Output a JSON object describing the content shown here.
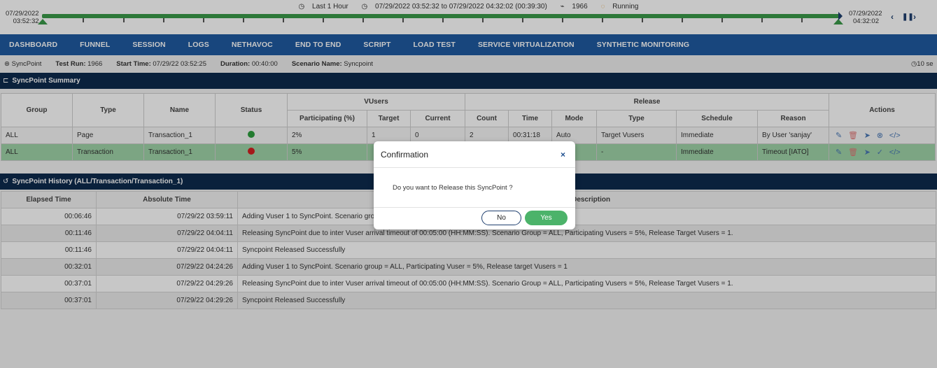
{
  "timeline": {
    "range_label": "Last 1 Hour",
    "time_window": "07/29/2022 03:52:32 to 07/29/2022 04:32:02 (00:39:30)",
    "test_run": "1966",
    "status": "Running",
    "start_date": "07/29/2022",
    "start_time": "03:52:32",
    "end_date": "07/29/2022",
    "end_time": "04:32:02"
  },
  "nav": {
    "items": [
      "DASHBOARD",
      "FUNNEL",
      "SESSION",
      "LOGS",
      "NETHAVOC",
      "END TO END",
      "SCRIPT",
      "LOAD TEST",
      "SERVICE VIRTUALIZATION",
      "SYNTHETIC MONITORING"
    ]
  },
  "info": {
    "page": "SyncPoint",
    "test_run_label": "Test Run:",
    "test_run_value": "1966",
    "start_label": "Start Time:",
    "start_value": "07/29/22 03:52:25",
    "duration_label": "Duration:",
    "duration_value": "00:40:00",
    "scenario_label": "Scenario Name:",
    "scenario_value": "Syncpoint",
    "refresh": "10 se"
  },
  "summary": {
    "title": "SyncPoint Summary",
    "headers": {
      "group": "Group",
      "type": "Type",
      "name": "Name",
      "status": "Status",
      "vusers": "VUsers",
      "release": "Release",
      "actions": "Actions",
      "participating": "Participating (%)",
      "target": "Target",
      "current": "Current",
      "count": "Count",
      "time": "Time",
      "mode": "Mode",
      "rtype": "Type",
      "schedule": "Schedule",
      "reason": "Reason"
    },
    "rows": [
      {
        "group": "ALL",
        "type": "Page",
        "name": "Transaction_1",
        "status_color": "#2e9e3e",
        "participating": "2%",
        "target": "1",
        "current": "0",
        "count": "2",
        "time": "00:31:18",
        "mode": "Auto",
        "rtype": "Target Vusers",
        "schedule": "Immediate",
        "reason": "By User 'sanjay'"
      },
      {
        "group": "ALL",
        "type": "Transaction",
        "name": "Transaction_1",
        "status_color": "#d42020",
        "participating": "5%",
        "target": "",
        "current": "",
        "count": "",
        "time": "",
        "mode": "al",
        "rtype": "-",
        "schedule": "Immediate",
        "reason": "Timeout [IATO]"
      }
    ]
  },
  "history": {
    "title": "SyncPoint History (ALL/Transaction/Transaction_1)",
    "headers": {
      "elapsed": "Elapsed Time",
      "absolute": "Absolute Time",
      "event": "nt Description"
    },
    "rows": [
      {
        "elapsed": "00:06:46",
        "absolute": "07/29/22 03:59:11",
        "event": "Adding Vuser 1 to SyncPoint. Scenario grou"
      },
      {
        "elapsed": "00:11:46",
        "absolute": "07/29/22 04:04:11",
        "event": "Releasing SyncPoint due to inter Vuser arrival timeout of 00:05:00 (HH:MM:SS). Scenario Group = ALL, Participating Vusers = 5%, Release Target Vusers = 1."
      },
      {
        "elapsed": "00:11:46",
        "absolute": "07/29/22 04:04:11",
        "event": "Syncpoint Released Successfully"
      },
      {
        "elapsed": "00:32:01",
        "absolute": "07/29/22 04:24:26",
        "event": "Adding Vuser 1 to SyncPoint. Scenario group = ALL, Participating Vuser = 5%, Release target Vusers = 1"
      },
      {
        "elapsed": "00:37:01",
        "absolute": "07/29/22 04:29:26",
        "event": "Releasing SyncPoint due to inter Vuser arrival timeout of 00:05:00 (HH:MM:SS). Scenario Group = ALL, Participating Vusers = 5%, Release Target Vusers = 1."
      },
      {
        "elapsed": "00:37:01",
        "absolute": "07/29/22 04:29:26",
        "event": "Syncpoint Released Successfully"
      }
    ]
  },
  "modal": {
    "title": "Confirmation",
    "close": "×",
    "message": "Do you want to Release  this SyncPoint ?",
    "no_label": "No",
    "yes_label": "Yes"
  },
  "colors": {
    "nav_bg": "#1f5aa0",
    "section_bg": "#0e2b4e",
    "timeline_green": "#3a9a4a",
    "selected_row": "#9fd4a8",
    "yes_button": "#4cb36a"
  }
}
